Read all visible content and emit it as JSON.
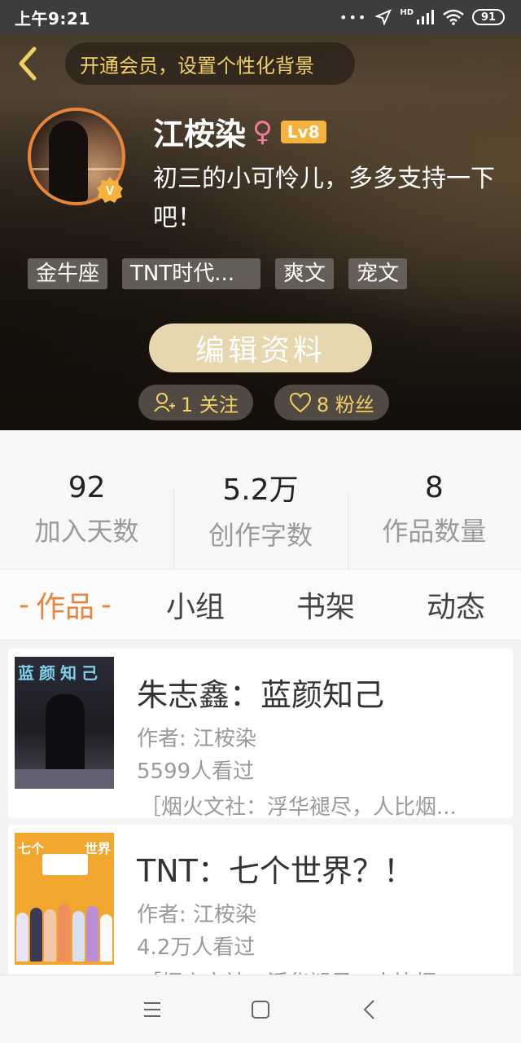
{
  "status_bar": {
    "time": "上午9:21",
    "battery": "91"
  },
  "vip_banner": "开通会员，设置个性化背景",
  "profile": {
    "name": "江桉染",
    "gender_symbol": "♀",
    "level": "Lv8",
    "verified_badge": "V",
    "bio": "初三的小可怜儿，多多支持一下吧！",
    "tags": [
      "金牛座",
      "TNT时代...",
      "爽文",
      "宠文"
    ]
  },
  "actions": {
    "edit_label": "编辑资料",
    "following_label": "1 关注",
    "followers_label": "8 粉丝"
  },
  "stats": [
    {
      "value": "92",
      "label": "加入天数"
    },
    {
      "value": "5.2万",
      "label": "创作字数"
    },
    {
      "value": "8",
      "label": "作品数量"
    }
  ],
  "tabs": [
    {
      "label": "作品",
      "active": true
    },
    {
      "label": "小组",
      "active": false
    },
    {
      "label": "书架",
      "active": false
    },
    {
      "label": "动态",
      "active": false
    }
  ],
  "tab_active_marker": "-",
  "works": [
    {
      "title": "朱志鑫：蓝颜知己",
      "author": "作者: 江桉染",
      "views": "5599人看过",
      "desc": "［烟火文社：浮华褪尽，人比烟...",
      "cover_text": "蓝颜知己"
    },
    {
      "title": "TNT：七个世界？！",
      "author": "作者: 江桉染",
      "views": "4.2万人看过",
      "desc": "［烟火文社：浮华褪尽，人比烟...",
      "cover_text_left": "七个",
      "cover_text_right": "世界"
    }
  ],
  "colors": {
    "accent": "#e8873b",
    "vip_text": "#f2d064",
    "level_badge": "#f6b23d",
    "edit_button": "#e6d7ae"
  },
  "icons": {
    "back": "chevron-left-icon",
    "verified": "verified-v-icon",
    "follow": "person-add-icon",
    "fans": "heart-icon",
    "nav_menu": "menu-icon",
    "nav_home": "square-home-icon",
    "nav_back": "back-triangle-icon"
  }
}
